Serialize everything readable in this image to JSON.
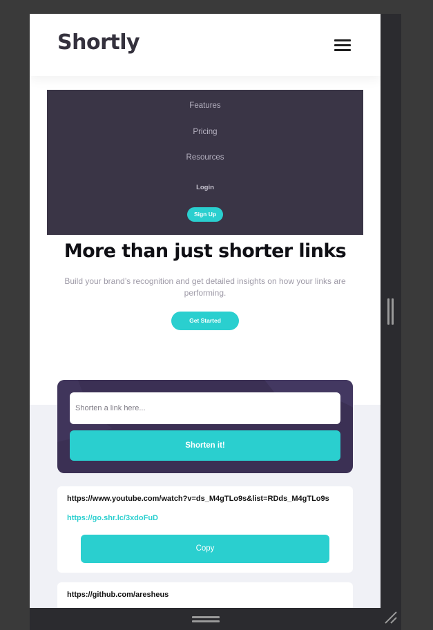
{
  "header": {
    "logo": "Shortly"
  },
  "menu": {
    "items": [
      {
        "label": "Features"
      },
      {
        "label": "Pricing"
      },
      {
        "label": "Resources"
      }
    ],
    "login_label": "Login",
    "signup_label": "Sign Up"
  },
  "hero": {
    "title": "More than just shorter links",
    "subtitle": "Build your brand’s recognition and get detailed insights on how your links are performing.",
    "cta_label": "Get Started"
  },
  "shorten": {
    "placeholder": "Shorten a link here...",
    "button_label": "Shorten it!"
  },
  "results": [
    {
      "original": "https://www.youtube.com/watch?v=ds_M4gTLo9s&list=RDds_M4gTLo9s",
      "short": "https://go.shr.lc/3xdoFuD",
      "copy_label": "Copy"
    },
    {
      "original": "https://github.com/aresheus"
    }
  ],
  "colors": {
    "accent": "#2acfcf",
    "menu_bg": "#3a3546",
    "card_bg": "#3b3054",
    "section_bg": "#f0f1f6",
    "logo": "#34313d"
  },
  "icons": [
    "hamburger-menu-icon",
    "resize-handle-icon",
    "drag-handle-icon"
  ]
}
